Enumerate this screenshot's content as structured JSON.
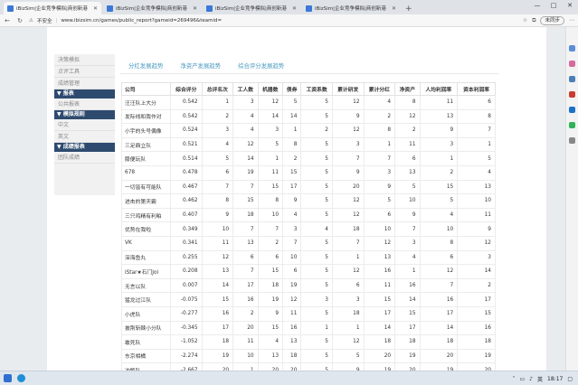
{
  "browser": {
    "tabs": [
      {
        "label": "iBizSim|企业竞争模拟|商创新港",
        "active": true
      },
      {
        "label": "iBizSim|企业竞争模拟|商创新港",
        "active": false
      },
      {
        "label": "iBizSim|企业竞争模拟|商创新港",
        "active": false
      },
      {
        "label": "iBizSim|企业竞争模拟|商创新港",
        "active": false
      }
    ],
    "new_tab": "+",
    "security_label": "不安全",
    "url": "www.ibizsim.cn/games/public_report?gameid=269496&teamid=",
    "user_button": "未同步",
    "window_controls": [
      "—",
      "□",
      "✕"
    ]
  },
  "sidebar": {
    "top_items": [
      "决策模拟",
      "点评工具",
      "成绩管理"
    ],
    "sections": [
      {
        "header": "▼ 报表",
        "items": [
          "公共报表"
        ]
      },
      {
        "header": "▼ 模拟规则",
        "items": [
          "中文",
          "英文"
        ]
      },
      {
        "header": "▼ 成绩报表",
        "items": [
          "团队成绩"
        ]
      }
    ]
  },
  "subtabs": [
    "分红发展趋势",
    "净资产发展趋势",
    "综合评分发展趋势"
  ],
  "table": {
    "headers": [
      "公司",
      "综合评分",
      "总评名次",
      "工人数",
      "机器数",
      "债券",
      "工资系数",
      "累计研发",
      "累计分红",
      "净资产",
      "人均利润率",
      "资本利润率"
    ],
    "rows": [
      [
        "汪汪队上大分",
        "0.542",
        "1",
        "3",
        "12",
        "5",
        "5",
        "12",
        "4",
        "8",
        "11",
        "6"
      ],
      [
        "发际线和我作对",
        "0.542",
        "2",
        "4",
        "14",
        "14",
        "5",
        "9",
        "2",
        "12",
        "13",
        "8"
      ],
      [
        "小宇的头号偶像",
        "0.524",
        "3",
        "4",
        "3",
        "1",
        "2",
        "12",
        "8",
        "2",
        "9",
        "7"
      ],
      [
        "三足鼎立队",
        "0.521",
        "4",
        "12",
        "5",
        "8",
        "5",
        "3",
        "1",
        "11",
        "3",
        "1"
      ],
      [
        "膝便玩队",
        "0.514",
        "5",
        "14",
        "1",
        "2",
        "5",
        "7",
        "7",
        "6",
        "1",
        "5"
      ],
      [
        "678",
        "0.478",
        "6",
        "19",
        "11",
        "15",
        "5",
        "9",
        "3",
        "13",
        "2",
        "4"
      ],
      [
        "一切皆有可能队",
        "0.467",
        "7",
        "7",
        "15",
        "17",
        "5",
        "20",
        "9",
        "5",
        "15",
        "13"
      ],
      [
        "进击的第天霸",
        "0.462",
        "8",
        "15",
        "8",
        "9",
        "5",
        "12",
        "5",
        "10",
        "5",
        "10"
      ],
      [
        "三只鸡精有利粕",
        "0.407",
        "9",
        "18",
        "10",
        "4",
        "5",
        "12",
        "6",
        "9",
        "4",
        "11"
      ],
      [
        "优势在我啦",
        "0.349",
        "10",
        "7",
        "7",
        "3",
        "4",
        "18",
        "10",
        "7",
        "10",
        "9"
      ],
      [
        "VK",
        "0.341",
        "11",
        "13",
        "2",
        "7",
        "5",
        "7",
        "12",
        "3",
        "8",
        "12"
      ],
      [
        "深海鱼丸",
        "0.255",
        "12",
        "6",
        "6",
        "10",
        "5",
        "1",
        "13",
        "4",
        "6",
        "3"
      ],
      [
        "iStar★石门Joi",
        "0.208",
        "13",
        "7",
        "15",
        "6",
        "5",
        "12",
        "16",
        "1",
        "12",
        "14"
      ],
      [
        "无言以队",
        "0.007",
        "14",
        "17",
        "18",
        "19",
        "5",
        "6",
        "11",
        "16",
        "7",
        "2"
      ],
      [
        "猛龙过江队",
        "-0.075",
        "15",
        "16",
        "19",
        "12",
        "3",
        "3",
        "15",
        "14",
        "16",
        "17"
      ],
      [
        "小虎队",
        "-0.277",
        "16",
        "2",
        "9",
        "11",
        "5",
        "18",
        "17",
        "15",
        "17",
        "15"
      ],
      [
        "披荆斩棘小分队",
        "-0.345",
        "17",
        "20",
        "15",
        "16",
        "1",
        "1",
        "14",
        "17",
        "14",
        "16"
      ],
      [
        "敢死队",
        "-1.052",
        "18",
        "11",
        "4",
        "13",
        "5",
        "12",
        "18",
        "18",
        "18",
        "18"
      ],
      [
        "东京相橘",
        "-2.274",
        "19",
        "10",
        "13",
        "18",
        "5",
        "5",
        "20",
        "19",
        "20",
        "19"
      ],
      [
        "冲鸭队",
        "-2.667",
        "20",
        "1",
        "20",
        "20",
        "5",
        "9",
        "19",
        "20",
        "19",
        "20"
      ]
    ]
  },
  "taskbar": {
    "lang": "英",
    "time": "18:17"
  }
}
